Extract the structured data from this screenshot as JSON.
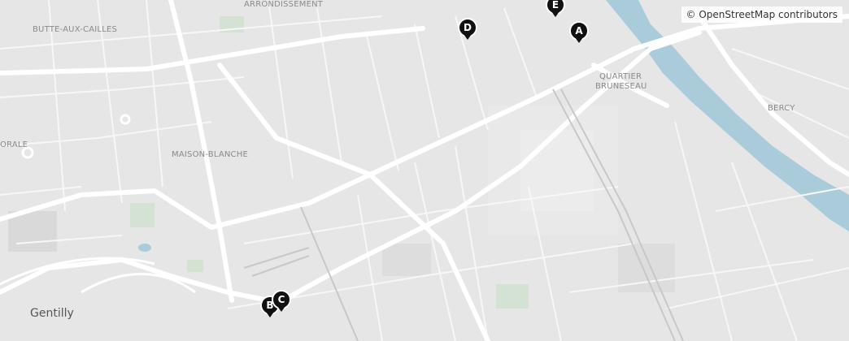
{
  "attribution": "© OpenStreetMap contributors",
  "colors": {
    "land": "#e6e6e6",
    "block": "#dcdcdc",
    "road": "#ffffff",
    "water": "#aacbd9",
    "park": "#d6e4d6",
    "marker": "#111111"
  },
  "places": {
    "arrondissement": "ARRONDISSEMENT",
    "butte_aux_cailles": "BUTTE-AUX-CAILLES",
    "quartier_bruneseau_1": "QUARTIER",
    "quartier_bruneseau_2": "BRUNESEAU",
    "bercy": "BERCY",
    "maison_blanche": "MAISON-BLANCHE",
    "orale": "ORALE",
    "gentilly": "Gentilly"
  },
  "markers": [
    {
      "id": "A",
      "label": "A"
    },
    {
      "id": "B",
      "label": "B"
    },
    {
      "id": "C",
      "label": "C"
    },
    {
      "id": "D",
      "label": "D"
    },
    {
      "id": "E",
      "label": "E"
    }
  ]
}
